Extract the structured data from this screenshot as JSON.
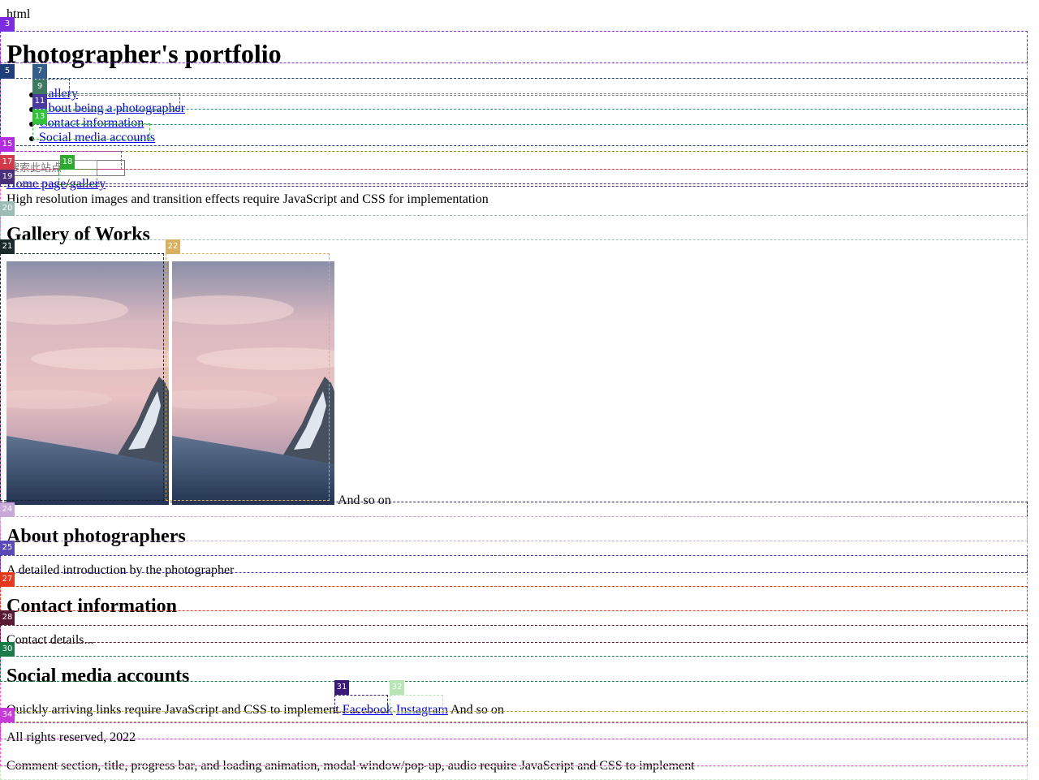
{
  "root_label": "html",
  "header": {
    "title": "Photographer's portfolio"
  },
  "nav": {
    "items": [
      {
        "label": "Gallery"
      },
      {
        "label": "About being a photographer"
      },
      {
        "label": "Contact information"
      },
      {
        "label": "Social media accounts"
      }
    ]
  },
  "search": {
    "placeholder": "搜索此站点"
  },
  "breadcrumb": {
    "home": "Home page",
    "separator": "/",
    "current": "gallery"
  },
  "notice": {
    "text": "High resolution images and transition effects require JavaScript and CSS for implementation"
  },
  "gallery": {
    "title": "Gallery of Works",
    "images": [
      {
        "icon": "mountain-sunset-photo"
      },
      {
        "icon": "mountain-sunset-photo"
      }
    ],
    "more_text": "And so on"
  },
  "about": {
    "title": "About photographers",
    "text": "A detailed introduction by the photographer"
  },
  "contact": {
    "title": "Contact information",
    "text": "Contact details..."
  },
  "social": {
    "title": "Social media accounts",
    "prefix": "Quickly arriving links require JavaScript and CSS to implement",
    "links": [
      {
        "label": "Facebook"
      },
      {
        "label": "Instagram"
      }
    ],
    "suffix": "And so on"
  },
  "footer": {
    "copyright": "All rights reserved, 2022",
    "note": "Comment section, title, progress bar, and loading animation, modal window/pop-up, audio require JavaScript and CSS to implement"
  },
  "overlay": {
    "badges": [
      "3",
      "5",
      "7",
      "9",
      "11",
      "13",
      "15",
      "17",
      "18",
      "19",
      "20",
      "21",
      "22",
      "24",
      "25",
      "27",
      "28",
      "30",
      "31",
      "32",
      "34"
    ]
  }
}
